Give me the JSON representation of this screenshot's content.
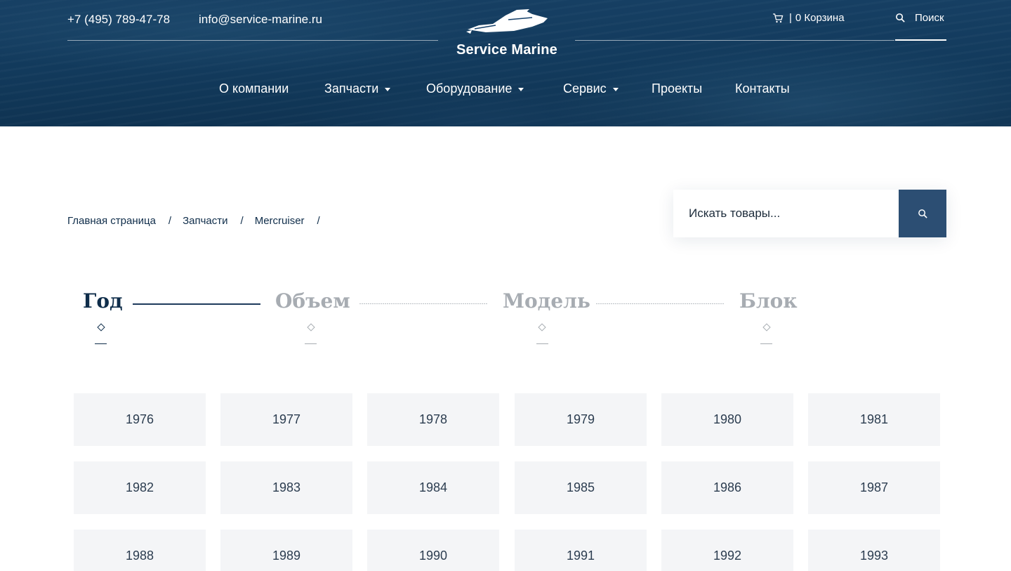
{
  "header": {
    "phone": "+7 (495) 789-47-78",
    "email": "info@service-marine.ru",
    "logo_text": "Service Marine",
    "cart_label": "0 Корзина",
    "cart_separator": "|",
    "search_label": "Поиск",
    "nav": [
      {
        "label": "О компании",
        "dropdown": false
      },
      {
        "label": "Запчасти",
        "dropdown": true
      },
      {
        "label": "Оборудование",
        "dropdown": true
      },
      {
        "label": "Сервис",
        "dropdown": true
      },
      {
        "label": "Проекты",
        "dropdown": false
      },
      {
        "label": "Контакты",
        "dropdown": false
      }
    ]
  },
  "breadcrumb": {
    "items": [
      "Главная страница",
      "Запчасти",
      "Mercruiser"
    ],
    "separator": "/"
  },
  "product_search": {
    "placeholder": "Искать товары..."
  },
  "steps": [
    {
      "label": "Год",
      "active": true
    },
    {
      "label": "Объем",
      "active": false
    },
    {
      "label": "Модель",
      "active": false
    },
    {
      "label": "Блок",
      "active": false
    }
  ],
  "years": [
    "1976",
    "1977",
    "1978",
    "1979",
    "1980",
    "1981",
    "1982",
    "1983",
    "1984",
    "1985",
    "1986",
    "1987",
    "1988",
    "1989",
    "1990",
    "1991",
    "1992",
    "1993"
  ],
  "icons": {
    "cart": "cart-icon",
    "search": "search-icon",
    "logo": "yacht-icon"
  },
  "colors": {
    "header_bg": "#123a5c",
    "accent": "#2c4e73",
    "text_dark": "#0f2d4a",
    "muted": "#a7acb2",
    "tile_bg": "#f4f5f7"
  }
}
